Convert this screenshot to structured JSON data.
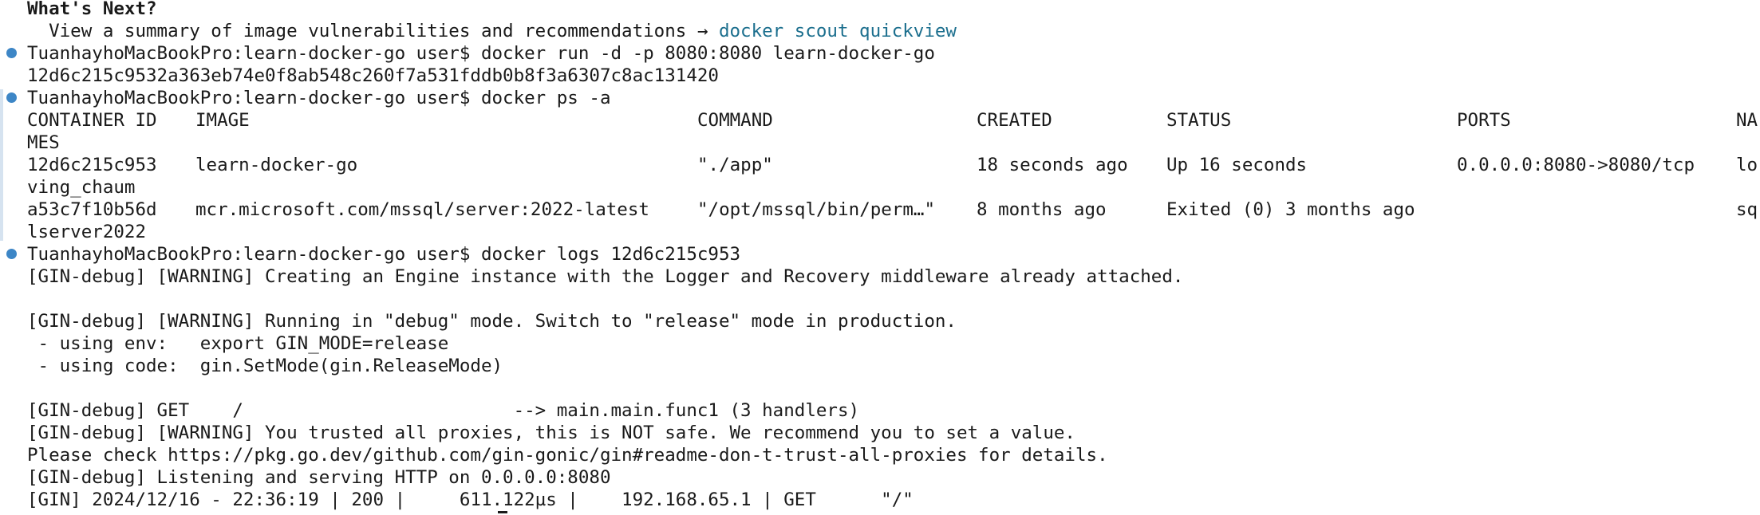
{
  "whats_next": {
    "heading": "What's Next?",
    "summary_text": "  View a summary of image vulnerabilities and recommendations → ",
    "summary_link": "docker scout quickview"
  },
  "commands": {
    "run": "TuanhayhoMacBookPro:learn-docker-go user$ docker run -d -p 8080:8080 learn-docker-go",
    "run_output": "12d6c215c9532a363eb74e0f8ab548c260f7a531fddb0b8f3a6307c8ac131420",
    "ps": "TuanhayhoMacBookPro:learn-docker-go user$ docker ps -a",
    "logs": "TuanhayhoMacBookPro:learn-docker-go user$ docker logs 12d6c215c953"
  },
  "ps_table": {
    "headers": {
      "container_id": "CONTAINER ID",
      "image": "IMAGE",
      "command": "COMMAND",
      "created": "CREATED",
      "status": "STATUS",
      "ports": "PORTS",
      "names_start": "NA",
      "names_wrap": "MES"
    },
    "rows": [
      {
        "container_id": "12d6c215c953",
        "image": "learn-docker-go",
        "command": "\"./app\"",
        "created": "18 seconds ago",
        "status": "Up 16 seconds",
        "ports": "0.0.0.0:8080->8080/tcp",
        "names_start": "lo",
        "names_wrap": "ving_chaum"
      },
      {
        "container_id": "a53c7f10b56d",
        "image": "mcr.microsoft.com/mssql/server:2022-latest",
        "command": "\"/opt/mssql/bin/perm…\"",
        "created": "8 months ago",
        "status": "Exited (0) 3 months ago",
        "ports": "",
        "names_start": "sq",
        "names_wrap": "lserver2022"
      }
    ]
  },
  "log_lines": [
    "[GIN-debug] [WARNING] Creating an Engine instance with the Logger and Recovery middleware already attached.",
    "",
    "[GIN-debug] [WARNING] Running in \"debug\" mode. Switch to \"release\" mode in production.",
    " - using env:   export GIN_MODE=release",
    " - using code:  gin.SetMode(gin.ReleaseMode)",
    "",
    "[GIN-debug] GET    /                         --> main.main.func1 (3 handlers)",
    "[GIN-debug] [WARNING] You trusted all proxies, this is NOT safe. We recommend you to set a value.",
    "Please check https://pkg.go.dev/github.com/gin-gonic/gin#readme-don-t-trust-all-proxies for details.",
    "[GIN-debug] Listening and serving HTTP on 0.0.0.0:8080",
    "[GIN] 2024/12/16 - 22:36:19 | 200 |     611.122µs |    192.168.65.1 | GET      \"/\""
  ],
  "colors": {
    "background": "#ffffff",
    "text": "#1a1a1a",
    "link": "#1c6f8e",
    "prompt_marker": "#3d86c6"
  }
}
